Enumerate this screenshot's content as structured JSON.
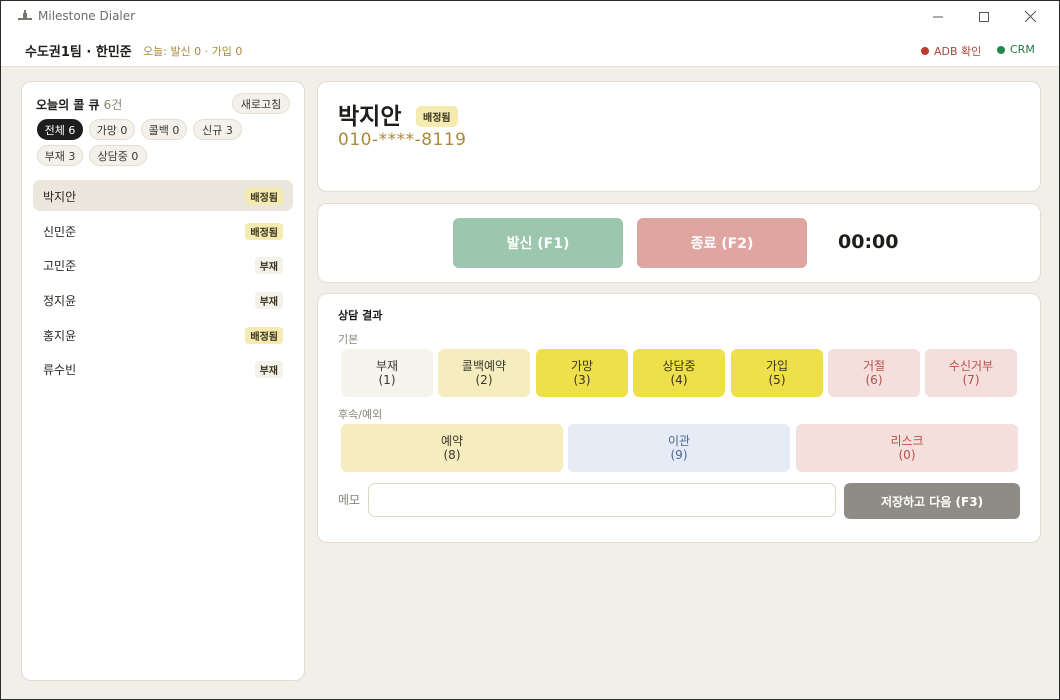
{
  "window": {
    "title": "Milestone Dialer",
    "minimize": "—",
    "maximize": "☐",
    "close": "✕"
  },
  "header": {
    "team": "수도권1팀 · 한민준",
    "today": "오늘: 발신 0 · 가입 0",
    "adb": {
      "label": "ADB 확인",
      "color": "#c0392b"
    },
    "crm": {
      "label": "CRM",
      "color": "#1e8a4c"
    }
  },
  "queue": {
    "title": "오늘의 콜 큐",
    "count": "6건",
    "refresh": "새로고침",
    "filters": [
      "전체 6",
      "가망 0",
      "콜백 0",
      "신규 3",
      "부재 3",
      "상담중 0"
    ],
    "items": [
      {
        "name": "박지안",
        "badge": "배정됨",
        "badge_type": "assigned"
      },
      {
        "name": "신민준",
        "badge": "배정됨",
        "badge_type": "assigned"
      },
      {
        "name": "고민준",
        "badge": "부재",
        "badge_type": "absent"
      },
      {
        "name": "정지윤",
        "badge": "부재",
        "badge_type": "absent"
      },
      {
        "name": "홍지윤",
        "badge": "배정됨",
        "badge_type": "assigned"
      },
      {
        "name": "류수빈",
        "badge": "부재",
        "badge_type": "absent"
      }
    ]
  },
  "customer": {
    "name": "박지안",
    "badge": "배정됨",
    "phone": "010-****-8119"
  },
  "call": {
    "dial": "발신 (F1)",
    "end": "종료 (F2)",
    "timer": "00:00",
    "dial_color": "#9dc6ae",
    "end_color": "#dfa5a1"
  },
  "result": {
    "title": "상담 결과",
    "basic_label": "기본",
    "basic": [
      {
        "label": "부재",
        "key": "(1)"
      },
      {
        "label": "콜백예약",
        "key": "(2)"
      },
      {
        "label": "가망",
        "key": "(3)"
      },
      {
        "label": "상담중",
        "key": "(4)"
      },
      {
        "label": "가입",
        "key": "(5)"
      },
      {
        "label": "거절",
        "key": "(6)"
      },
      {
        "label": "수신거부",
        "key": "(7)"
      }
    ],
    "followup_label": "후속/예외",
    "followup": [
      {
        "label": "예약",
        "key": "(8)"
      },
      {
        "label": "이관",
        "key": "(9)"
      },
      {
        "label": "리스크",
        "key": "(0)"
      }
    ],
    "memo_label": "메모",
    "memo_value": "",
    "save": "저장하고 다음 (F3)"
  }
}
